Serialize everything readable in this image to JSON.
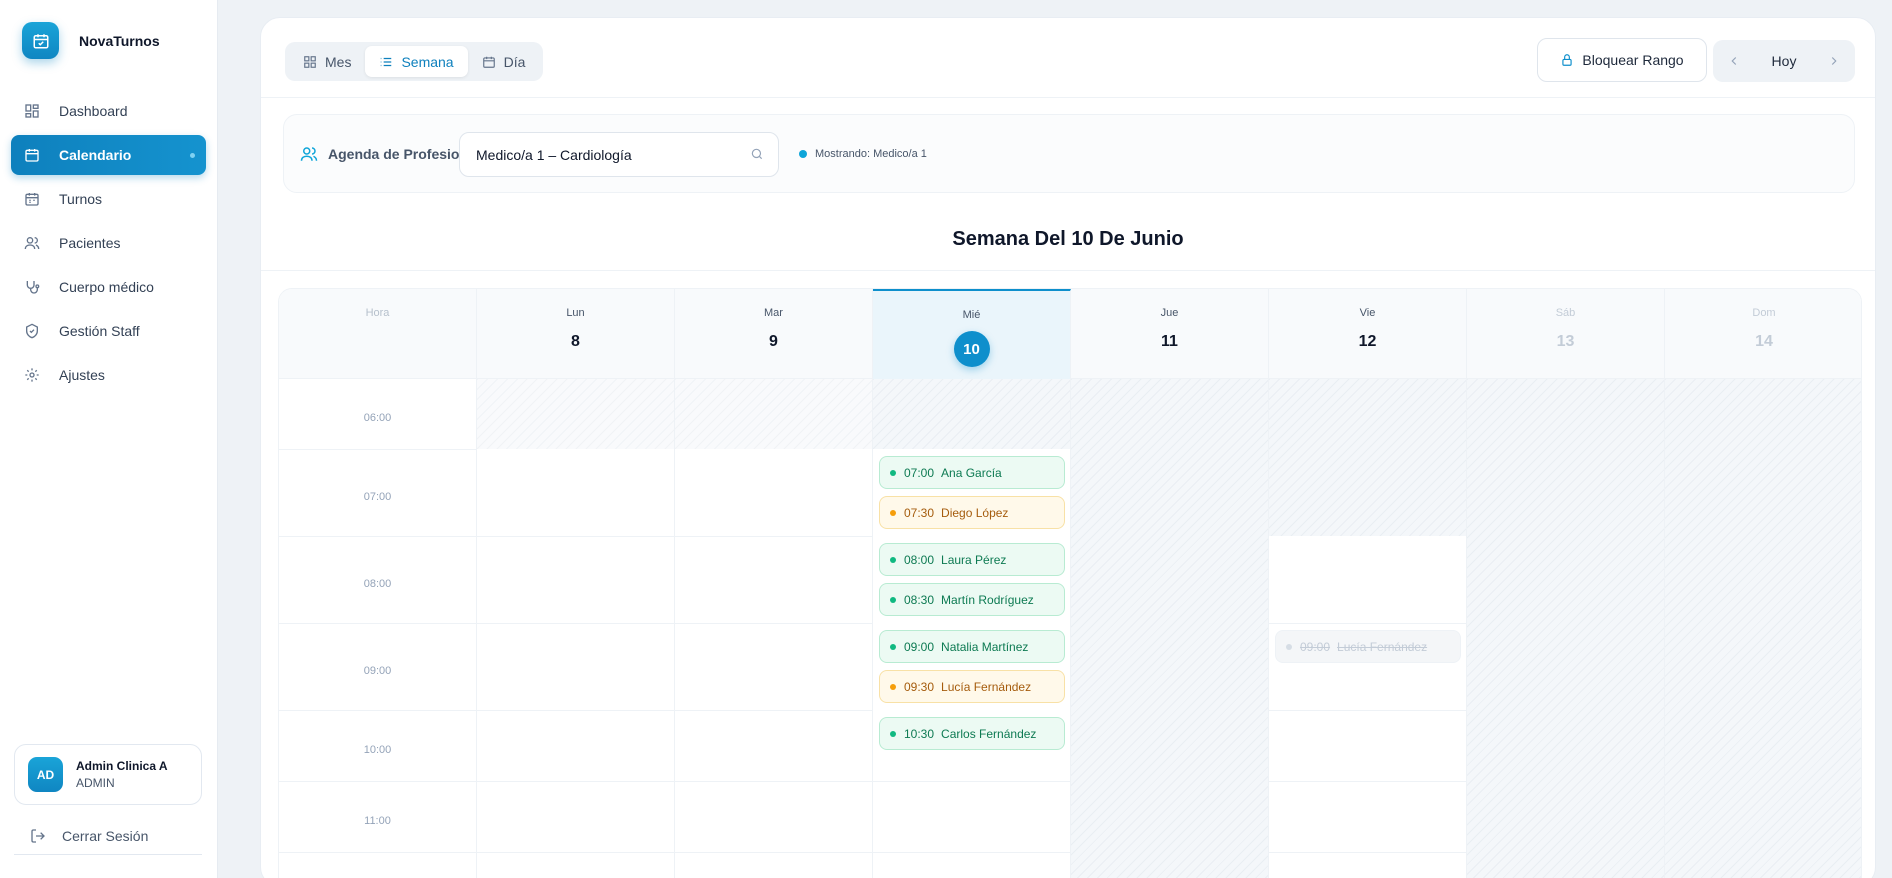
{
  "brand": {
    "name": "NovaTurnos"
  },
  "nav": [
    {
      "label": "Dashboard",
      "icon": "grid-icon"
    },
    {
      "label": "Calendario",
      "icon": "calendar-icon",
      "active": true
    },
    {
      "label": "Turnos",
      "icon": "calendar-days-icon"
    },
    {
      "label": "Pacientes",
      "icon": "users-icon"
    },
    {
      "label": "Cuerpo médico",
      "icon": "stethoscope-icon"
    },
    {
      "label": "Gestión Staff",
      "icon": "shield-icon"
    },
    {
      "label": "Ajustes",
      "icon": "gear-icon"
    }
  ],
  "user": {
    "initials": "AD",
    "name": "Admin Clinica A",
    "role": "ADMIN"
  },
  "logout_label": "Cerrar Sesión",
  "views": {
    "month": "Mes",
    "week": "Semana",
    "day": "Día",
    "active": "week"
  },
  "block_range_label": "Bloquear Rango",
  "today_label": "Hoy",
  "filter": {
    "label": "Agenda de Profesionales",
    "value": "Medico/a 1 – Cardiología",
    "showing": "Mostrando: Medico/a 1"
  },
  "week_title": "Semana Del 10 De Junio",
  "calendar": {
    "hour_header": "Hora",
    "days": [
      {
        "name": "Lun",
        "num": "8"
      },
      {
        "name": "Mar",
        "num": "9"
      },
      {
        "name": "Mié",
        "num": "10",
        "today": true
      },
      {
        "name": "Jue",
        "num": "11"
      },
      {
        "name": "Vie",
        "num": "12"
      },
      {
        "name": "Sáb",
        "num": "13",
        "muted": true
      },
      {
        "name": "Dom",
        "num": "14",
        "muted": true
      }
    ],
    "hours": [
      "06:00",
      "07:00",
      "08:00",
      "09:00",
      "10:00",
      "11:00"
    ],
    "appointments": [
      {
        "day": 2,
        "time": "07:00",
        "name": "Ana García",
        "status": "confirmed"
      },
      {
        "day": 2,
        "time": "07:30",
        "name": "Diego López",
        "status": "pending"
      },
      {
        "day": 2,
        "time": "08:00",
        "name": "Laura Pérez",
        "status": "confirmed"
      },
      {
        "day": 2,
        "time": "08:30",
        "name": "Martín Rodríguez",
        "status": "confirmed"
      },
      {
        "day": 2,
        "time": "09:00",
        "name": "Natalia Martínez",
        "status": "confirmed"
      },
      {
        "day": 2,
        "time": "09:30",
        "name": "Lucía Fernández",
        "status": "pending"
      },
      {
        "day": 2,
        "time": "10:30",
        "name": "Carlos Fernández",
        "status": "confirmed"
      },
      {
        "day": 4,
        "time": "09:00",
        "name": "Lucía Fernández",
        "status": "cancelled"
      }
    ]
  },
  "colors": {
    "accent": "#0e8fcc",
    "confirmed": "#10b981",
    "pending": "#f59e0b"
  }
}
